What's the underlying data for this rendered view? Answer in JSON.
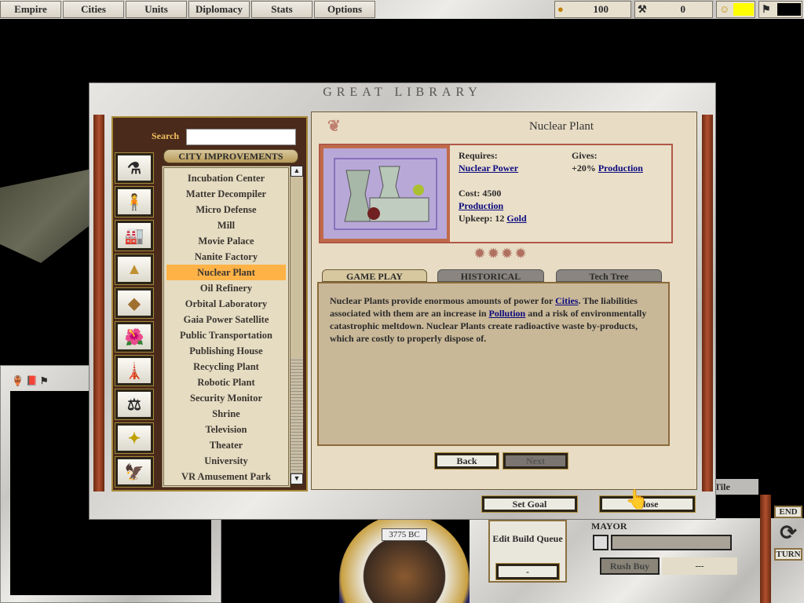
{
  "topbar": {
    "buttons": [
      "Empire",
      "Cities",
      "Units",
      "Diplomacy",
      "Stats",
      "Options"
    ],
    "gold": "100",
    "production": "0",
    "accent_yellow": "#ffff00"
  },
  "library": {
    "title": "GREAT LIBRARY",
    "search_label": "Search",
    "search_value": "",
    "category": "CITY IMPROVEMENTS",
    "category_icons": [
      "science-flask-icon",
      "unit-person-icon",
      "improvement-icon",
      "wonder-pyramid-icon",
      "terrain-icon",
      "tile-improvement-icon",
      "concept-icon",
      "government-scales-icon",
      "advance-icon",
      "great-seal-icon"
    ],
    "items": [
      "Incubation Center",
      "Matter Decompiler",
      "Micro Defense",
      "Mill",
      "Movie Palace",
      "Nanite Factory",
      "Nuclear Plant",
      "Oil Refinery",
      "Orbital Laboratory",
      "Gaia Power Satellite",
      "Public Transportation",
      "Publishing House",
      "Recycling Plant",
      "Robotic Plant",
      "Security Monitor",
      "Shrine",
      "Television",
      "Theater",
      "University",
      "VR Amusement Park"
    ],
    "selected_index": 6,
    "entry": {
      "name": "Nuclear Plant",
      "requires_label": "Requires:",
      "requires": "Nuclear Power",
      "gives_label": "Gives:",
      "gives_prefix": "+20%",
      "gives_link": "Production",
      "cost_label": "Cost: 4500",
      "cost_link": "Production",
      "upkeep_label": "Upkeep: 12",
      "upkeep_link": "Gold"
    },
    "tabs": [
      "GAME PLAY",
      "HISTORICAL",
      "Tech Tree"
    ],
    "active_tab": 0,
    "text": {
      "p1": "Nuclear Plants provide enormous amounts of power for ",
      "l1": "Cities",
      "p2": ".  The liabilities associated with them are an increase in ",
      "l2": "Pollution",
      "p3": " and a risk of environmentally catastrophic meltdown.  Nuclear Plants create radioactive waste by-products, which are costly to properly dispose of."
    },
    "back": "Back",
    "next": "Next",
    "set_goal": "Set Goal",
    "close": "Close"
  },
  "bottom": {
    "date": "3775 BC",
    "edit_build_queue": "Edit Build Queue",
    "queue_value": "-",
    "mayor": "MAYOR",
    "rush_buy": "Rush Buy",
    "rush_value": "---",
    "end": "END",
    "turn": "TURN",
    "tile_tab": "Tile"
  }
}
